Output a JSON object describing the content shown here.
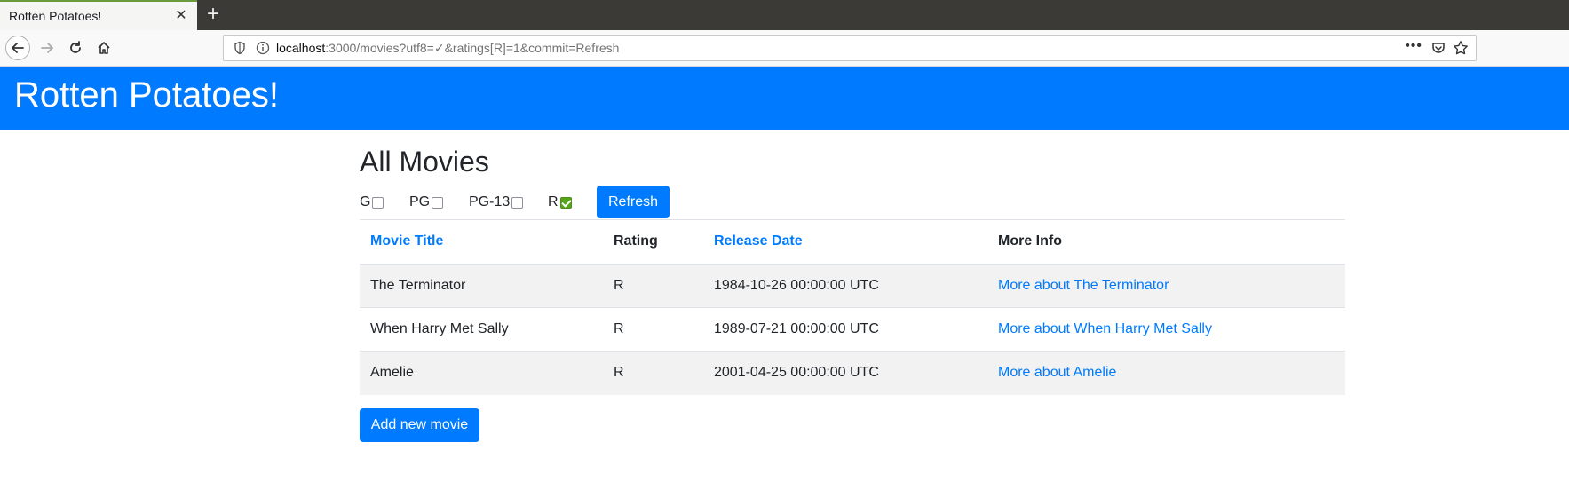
{
  "browser": {
    "tab_title": "Rotten Potatoes!",
    "tab_close": "✕",
    "new_tab": "+",
    "url_host": "localhost",
    "url_rest": ":3000/movies?utf8=✓&ratings[R]=1&commit=Refresh",
    "url_dots": "•••"
  },
  "header": {
    "title": "Rotten Potatoes!"
  },
  "main": {
    "title": "All Movies",
    "filters": [
      {
        "label": "G",
        "checked": false
      },
      {
        "label": "PG",
        "checked": false
      },
      {
        "label": "PG-13",
        "checked": false
      },
      {
        "label": "R",
        "checked": true
      }
    ],
    "refresh_label": "Refresh",
    "add_label": "Add new movie"
  },
  "table": {
    "headers": [
      "Movie Title",
      "Rating",
      "Release Date",
      "More Info"
    ],
    "rows": [
      {
        "title": "The Terminator",
        "rating": "R",
        "release": "1984-10-26 00:00:00 UTC",
        "info": "More about The Terminator"
      },
      {
        "title": "When Harry Met Sally",
        "rating": "R",
        "release": "1989-07-21 00:00:00 UTC",
        "info": "More about When Harry Met Sally"
      },
      {
        "title": "Amelie",
        "rating": "R",
        "release": "2001-04-25 00:00:00 UTC",
        "info": "More about Amelie"
      }
    ]
  },
  "colors": {
    "brand": "#007bff",
    "checkbox_checked": "#55a51c"
  }
}
